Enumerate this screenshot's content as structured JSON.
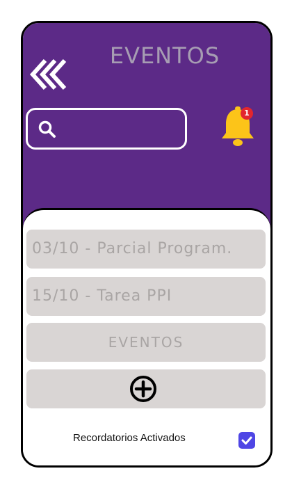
{
  "header": {
    "title": "EVENTOS",
    "back_icon": "triple-chevron-left-icon",
    "search": {
      "value": "",
      "placeholder": "",
      "icon": "search-icon"
    },
    "notifications": {
      "icon": "bell-icon",
      "count": "1"
    }
  },
  "events": [
    {
      "label": "03/10 - Parcial Program."
    },
    {
      "label": "15/10 - Tarea PPI"
    }
  ],
  "events_button_label": "EVENTOS",
  "add_icon": "plus-circle-icon",
  "reminders": {
    "label": "Recordatorios Activados",
    "checked": true
  },
  "colors": {
    "header_bg": "#5c2a87",
    "title": "#a79db3",
    "bell": "#fcc419",
    "badge": "#e2262e",
    "row_bg": "#d9d5d4",
    "row_text": "#a9a5a4",
    "checkbox": "#4f46e5"
  }
}
